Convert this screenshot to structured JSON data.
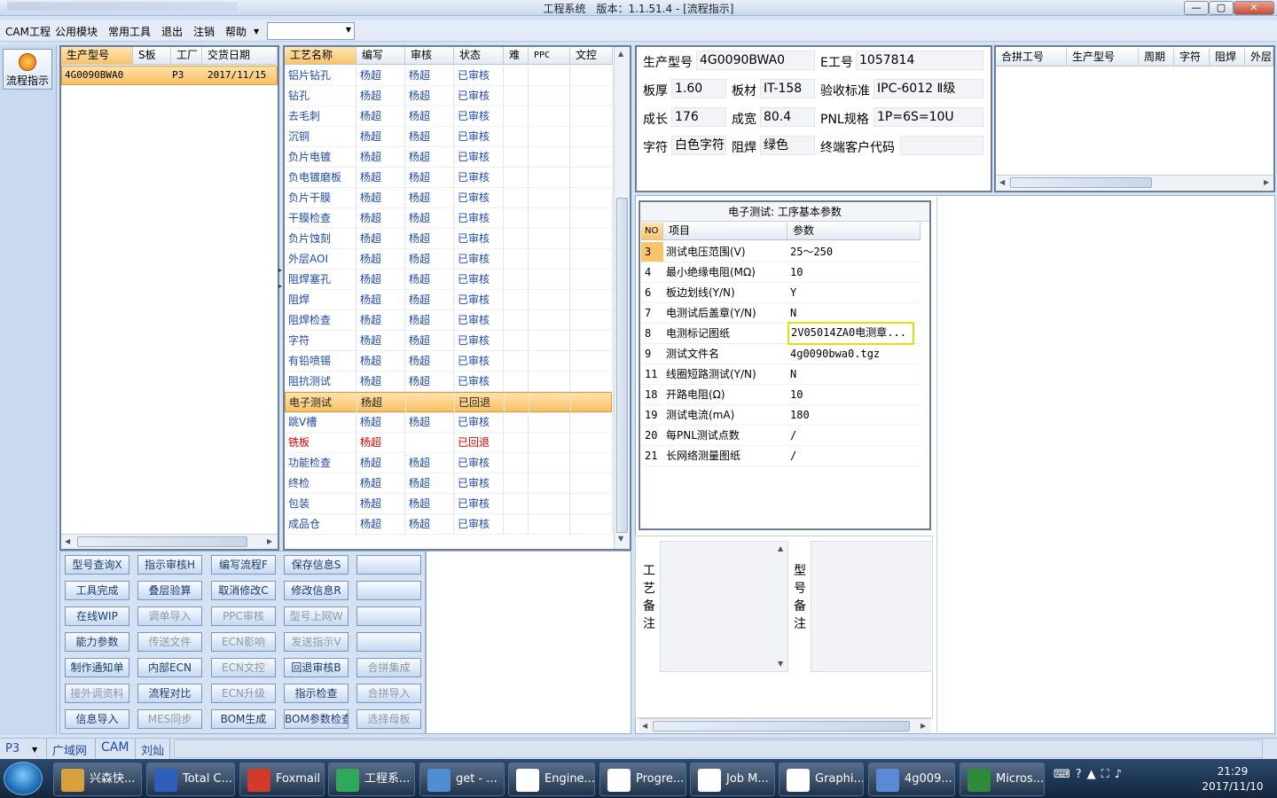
{
  "window": {
    "title": "工程系统　版本：1.1.51.4 - [流程指示]",
    "min": "—",
    "max": "▢",
    "close": "✕"
  },
  "menubar": {
    "items": [
      "CAM工程",
      "公用模块",
      "常用工具",
      "退出",
      "注销",
      "帮助"
    ],
    "combo_value": ""
  },
  "mdi": {
    "min": "—",
    "restore": "❐",
    "close": "✕"
  },
  "leftnav": {
    "flow_label": "流程指示"
  },
  "orders": {
    "headers": [
      "生产型号",
      "S板",
      "工厂",
      "交货日期"
    ],
    "rows": [
      [
        "4G0090BWA0",
        "",
        "P3",
        "2017/11/15"
      ]
    ]
  },
  "process": {
    "headers": [
      "工艺名称",
      "编写",
      "审核",
      "状态",
      "难",
      "PPC",
      "文控"
    ],
    "rows": [
      [
        "铝片钻孔",
        "杨超",
        "杨超",
        "已审核"
      ],
      [
        "钻孔",
        "杨超",
        "杨超",
        "已审核"
      ],
      [
        "去毛刺",
        "杨超",
        "杨超",
        "已审核"
      ],
      [
        "沉铜",
        "杨超",
        "杨超",
        "已审核"
      ],
      [
        "负片电镀",
        "杨超",
        "杨超",
        "已审核"
      ],
      [
        "负电镀磨板",
        "杨超",
        "杨超",
        "已审核"
      ],
      [
        "负片干膜",
        "杨超",
        "杨超",
        "已审核"
      ],
      [
        "干膜检查",
        "杨超",
        "杨超",
        "已审核"
      ],
      [
        "负片蚀刻",
        "杨超",
        "杨超",
        "已审核"
      ],
      [
        "外层AOI",
        "杨超",
        "杨超",
        "已审核"
      ],
      [
        "阻焊塞孔",
        "杨超",
        "杨超",
        "已审核"
      ],
      [
        "阻焊",
        "杨超",
        "杨超",
        "已审核"
      ],
      [
        "阻焊检查",
        "杨超",
        "杨超",
        "已审核"
      ],
      [
        "字符",
        "杨超",
        "杨超",
        "已审核"
      ],
      [
        "有铅喷锡",
        "杨超",
        "杨超",
        "已审核"
      ],
      [
        "阻抗测试",
        "杨超",
        "杨超",
        "已审核"
      ],
      [
        "电子测试",
        "杨超",
        "",
        "已回退"
      ],
      [
        "跳V槽",
        "杨超",
        "杨超",
        "已审核"
      ],
      [
        "铣板",
        "杨超",
        "",
        "已回退"
      ],
      [
        "功能检查",
        "杨超",
        "杨超",
        "已审核"
      ],
      [
        "终检",
        "杨超",
        "杨超",
        "已审核"
      ],
      [
        "包装",
        "杨超",
        "杨超",
        "已审核"
      ],
      [
        "成品仓",
        "杨超",
        "杨超",
        "已审核"
      ]
    ],
    "selected_row": 16,
    "red_row": 18
  },
  "buttons": [
    [
      "型号查询X",
      "指示审核H",
      "编写流程F",
      "保存信息S",
      ""
    ],
    [
      "工具完成",
      "叠层验算",
      "取消修改C",
      "修改信息R",
      ""
    ],
    [
      "在线WIP",
      "调单导入",
      "PPC审核",
      "型号上网W",
      ""
    ],
    [
      "能力参数",
      "传送文件",
      "ECN影响",
      "发送指示V",
      ""
    ],
    [
      "制作通知单",
      "内部ECN",
      "ECN文控",
      "回退审核B",
      "合拼集成"
    ],
    [
      "接外调资料",
      "流程对比",
      "ECN升级",
      "指示检查",
      "合拼导入"
    ],
    [
      "信息导入",
      "MES同步",
      "BOM生成",
      "BOM参数检查",
      "选择母板"
    ]
  ],
  "buttons_disabled": [
    "调单导入",
    "PPC审核",
    "型号上网W",
    "传送文件",
    "ECN影响",
    "发送指示V",
    "ECN文控",
    "合拼集成",
    "接外调资料",
    "ECN升级",
    "合拼导入",
    "MES同步",
    "选择母板"
  ],
  "info": {
    "model_label": "生产型号",
    "model_value": "4G0090BWA0",
    "eno_label": "E工号",
    "eno_value": "1057814",
    "thick_label": "板厚",
    "thick_value": "1.60",
    "material_label": "板材",
    "material_value": "IT-158",
    "std_label": "验收标准",
    "std_value": "IPC-6012 Ⅱ级",
    "len_label": "成长",
    "len_value": "176",
    "wid_label": "成宽",
    "wid_value": "80.4",
    "pnl_label": "PNL规格",
    "pnl_value": "1P=6S=10U",
    "char_label": "字符",
    "char_value": "白色字符",
    "mask_label": "阻焊",
    "mask_value": "绿色",
    "cust_label": "终端客户代码",
    "cust_value": ""
  },
  "merge": {
    "headers": [
      "合拼工号",
      "生产型号",
      "周期",
      "字符",
      "阻焊",
      "外层"
    ]
  },
  "params": {
    "title": "电子测试: 工序基本参数",
    "headers": [
      "NO",
      "项目",
      "参数"
    ],
    "rows": [
      [
        "3",
        "测试电压范围(V)",
        "25～250"
      ],
      [
        "4",
        "最小绝缘电阻(MΩ)",
        "10"
      ],
      [
        "6",
        "板边划线(Y/N)",
        "Y"
      ],
      [
        "7",
        "电测试后盖章(Y/N)",
        "N"
      ],
      [
        "8",
        "电测标记图纸",
        "2V05014ZA0电测章..."
      ],
      [
        "9",
        "测试文件名",
        "4g0090bwa0.tgz"
      ],
      [
        "11",
        "线圈短路测试(Y/N)",
        "N"
      ],
      [
        "18",
        "开路电阻(Ω)",
        "10"
      ],
      [
        "19",
        "测试电流(mA)",
        "180"
      ],
      [
        "20",
        "每PNL测试点数",
        "/"
      ],
      [
        "21",
        "长网络测量图纸",
        "/"
      ]
    ],
    "highlight_row": 4
  },
  "notes": {
    "process_label": "工艺备注",
    "model_label": "型号备注"
  },
  "statusbar": {
    "site": "P3",
    "items": [
      "广域网",
      "CAM",
      "刘灿"
    ]
  },
  "taskbar": {
    "items": [
      "兴森快...",
      "Total C...",
      "Foxmail",
      "工程系...",
      "get - ...",
      "Engine...",
      "Progre...",
      "Job M...",
      "Graphi...",
      "4g009...",
      "Micros..."
    ],
    "time": "21:29",
    "date": "2017/11/10"
  },
  "colors": {
    "accent": "#f9c46a",
    "link": "#1f4aa8",
    "red": "#e00000",
    "highlight": "#e8e000"
  }
}
